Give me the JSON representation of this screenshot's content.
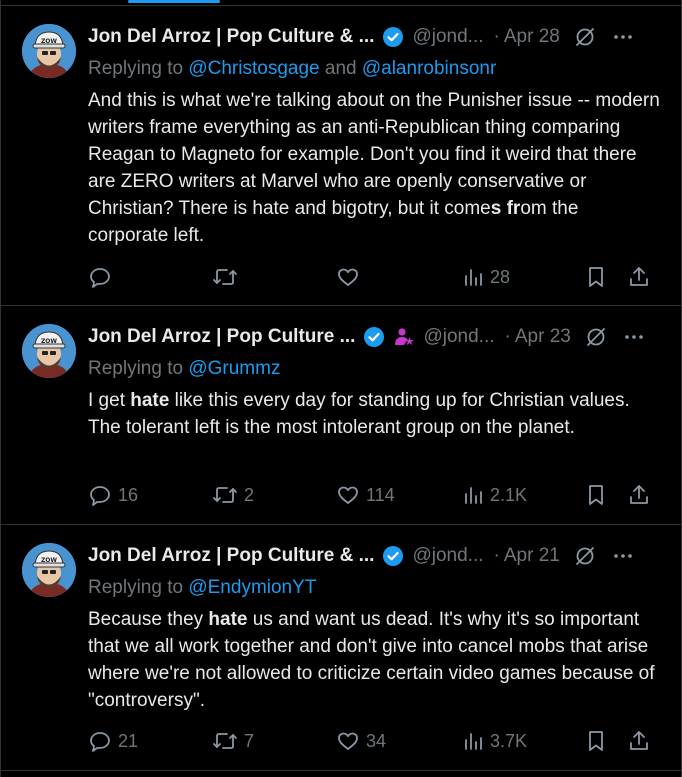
{
  "tweets": [
    {
      "name": "Jon Del Arroz | Pop Culture & ...",
      "handle": "@jond...",
      "date": "Apr 28",
      "replying_prefix": "Replying to ",
      "mention_1": "@Christosgage",
      "replying_join": " and ",
      "mention_2": "@alanrobinsonr",
      "text_1": "And this is what we're talking about on the Punisher issue -- modern writers frame everything as an anti-Republican thing comparing Reagan to Magneto for example. Don't you find it weird that there are ZERO writers at Marvel who are openly conservative or Christian? There is hate and bigotry, but it come",
      "text_bold_1": "s fr",
      "text_2": "om the corporate left.",
      "replies": "",
      "reposts": "",
      "likes": "",
      "views": "28"
    },
    {
      "name": "Jon Del Arroz | Pop Culture ...",
      "handle": "@jond...",
      "date": "Apr 23",
      "replying_prefix": "Replying to ",
      "mention_1": "@Grummz",
      "text_1": "I get ",
      "text_bold_1": "hate",
      "text_2": " like this every day for standing up for Christian values. The tolerant left is the most intolerant group on the planet.",
      "replies": "16",
      "reposts": "2",
      "likes": "114",
      "views": "2.1K"
    },
    {
      "name": "Jon Del Arroz | Pop Culture & ...",
      "handle": "@jond...",
      "date": "Apr 21",
      "replying_prefix": "Replying to ",
      "mention_1": "@EndymionYT",
      "text_1": "Because they ",
      "text_bold_1": "hate",
      "text_2": " us and want us dead. It's why it's so important that we all work together and don't give into cancel mobs that arise where we're not allowed to criticize certain video games because of \"controversy\".",
      "replies": "21",
      "reposts": "7",
      "likes": "34",
      "views": "3.7K"
    }
  ],
  "colors": {
    "background": "#000000",
    "text": "#e7e9ea",
    "muted": "#71767b",
    "link": "#1d9bf0",
    "verified": "#1d9bf0",
    "affiliate": "#c936cc",
    "divider": "#2f3336"
  },
  "icons": [
    "verified-badge-icon",
    "affiliate-badge-icon",
    "grok-icon",
    "more-icon",
    "reply-icon",
    "repost-icon",
    "like-icon",
    "views-icon",
    "bookmark-icon",
    "share-icon"
  ]
}
